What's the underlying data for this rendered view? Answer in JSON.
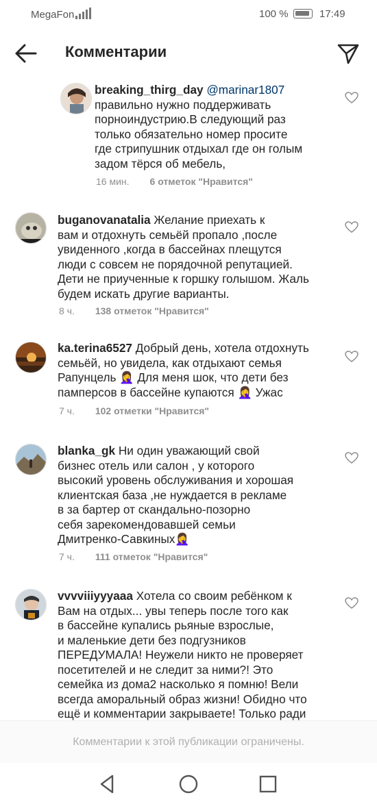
{
  "status": {
    "carrier": "MegaFon",
    "battery": "100 %",
    "time": "17:49"
  },
  "header": {
    "title": "Комментарии",
    "back_icon": "arrow-left-icon",
    "send_icon": "paper-plane-icon"
  },
  "comments": [
    {
      "username": "breaking_thirg_day",
      "mention": "@marinar1807",
      "text": "правильно нужно поддерживать\nпорноиндустрию.В следующий раз\nтолько обязательно номер просите\nгде стрипушник отдыхал где он голым\nзадом тёрся об мебель,",
      "time": "16 мин.",
      "likes": "6 отметок \"Нравится\""
    },
    {
      "username": "buganovanatalia",
      "text": "Желание приехать к\nвам и отдохнуть семьёй пропало ,после\nувиденного ,когда в бассейнах плещутся\nлюди с совсем не порядочной репутацией.\nДети не приученные к горшку голышом. Жаль\nбудем искать другие варианты.",
      "time": "8 ч.",
      "likes": "138 отметок \"Нравится\""
    },
    {
      "username": "ka.terina6527",
      "text": "Добрый день, хотела отдохнуть\nсемьёй, но увидела, как отдыхают семья\nРапунцель 🤦‍♀️ Для меня шок, что дети без\nпамперсов в бассейне купаются 🤦‍♀️ Ужас",
      "time": "7 ч.",
      "likes": "102 отметки \"Нравится\""
    },
    {
      "username": "blanka_gk",
      "text": "Ни один уважающий свой\nбизнес отель или салон , у которого\nвысокий уровень обслуживания и хорошая\nклиентская база ,не нуждается в рекламе\nв за бартер от скандально-позорно\nсебя зарекомендовавшей семьи\nДмитренко-Савкиных🤦‍♀️",
      "time": "7 ч.",
      "likes": "111 отметок \"Нравится\""
    },
    {
      "username": "vvvviiiyyyaaa",
      "text": "Хотела со своим ребёнком к\nВам на отдых... увы теперь после того как\nв бассейне купались рьяные взрослые,\nи маленькие дети без подгузников\nПЕРЕДУМАЛА! Неужели никто не проверяет\nпосетителей и не следит за ними?! Это\nсемейка из дома2 насколько я помню! Вели\nвсегда аморальный образ жизни! Обидно что\nещё и комментарии закрываете! Только ради",
      "time": "",
      "likes": ""
    }
  ],
  "footer": {
    "limited_text": "Комментарии к этой публикации ограничены."
  },
  "navbar": {
    "back": "triangle-back-icon",
    "home": "circle-home-icon",
    "recents": "square-recents-icon"
  }
}
